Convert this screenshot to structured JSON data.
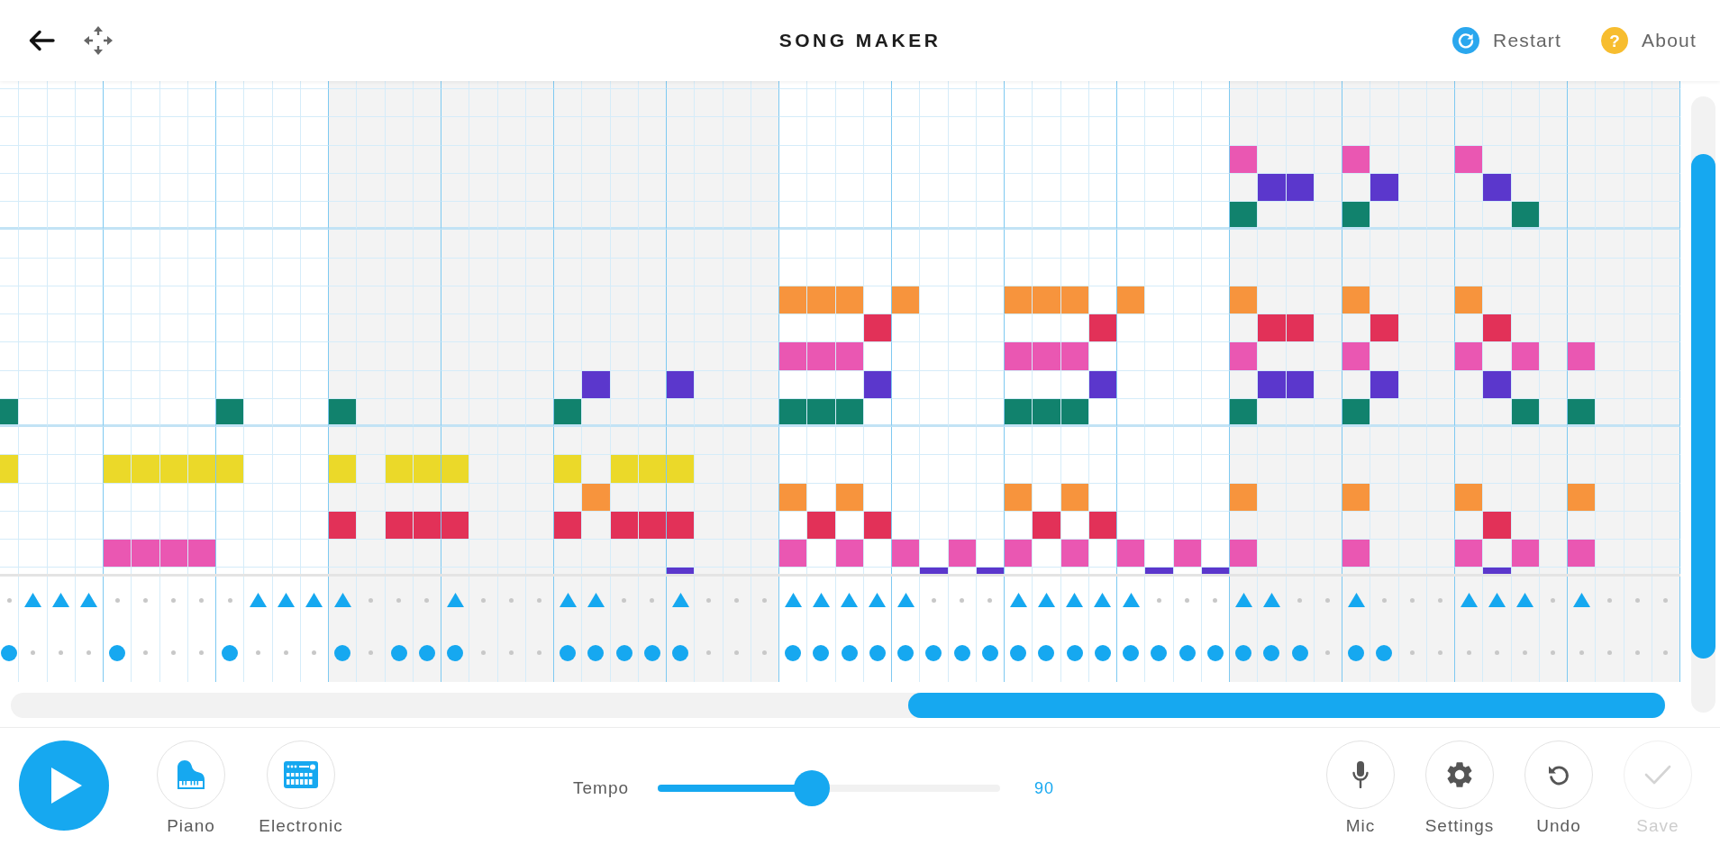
{
  "header": {
    "title": "SONG MAKER",
    "actions": [
      {
        "kind": "restart",
        "label": "Restart"
      },
      {
        "kind": "about",
        "label": "About",
        "icon": "?"
      }
    ]
  },
  "melody": {
    "rows": [
      {
        "cells": [
          false,
          false,
          false,
          false,
          false,
          false,
          false,
          false,
          false,
          false,
          false,
          false,
          false,
          false,
          false,
          false,
          false,
          false,
          false,
          false,
          false,
          false,
          false,
          false,
          false,
          false,
          false,
          false,
          false,
          false,
          false,
          false,
          false,
          false,
          false,
          false,
          false,
          false,
          false,
          false,
          false,
          false,
          false,
          false,
          false,
          false,
          false,
          false,
          false,
          false,
          false,
          false,
          false,
          false,
          false,
          false,
          false,
          false,
          false,
          false
        ]
      },
      {
        "cells": [
          false,
          false,
          false,
          false,
          false,
          false,
          false,
          false,
          false,
          false,
          false,
          false,
          false,
          false,
          false,
          false,
          false,
          false,
          false,
          false,
          false,
          false,
          false,
          false,
          false,
          false,
          false,
          false,
          false,
          false,
          false,
          false,
          false,
          false,
          false,
          false,
          false,
          false,
          false,
          false,
          false,
          false,
          false,
          false,
          false,
          false,
          false,
          false,
          false,
          false,
          false,
          false,
          false,
          false,
          false,
          false,
          false,
          false,
          false,
          false
        ]
      },
      {
        "color": "#ea57b2",
        "cells": [
          false,
          false,
          false,
          false,
          false,
          false,
          false,
          false,
          false,
          false,
          false,
          false,
          false,
          false,
          false,
          false,
          false,
          false,
          false,
          false,
          false,
          false,
          false,
          false,
          false,
          false,
          false,
          false,
          false,
          false,
          false,
          false,
          false,
          false,
          false,
          false,
          false,
          false,
          false,
          false,
          false,
          false,
          false,
          false,
          true,
          false,
          false,
          false,
          true,
          false,
          false,
          false,
          true,
          false,
          false,
          false,
          false,
          false,
          false,
          false
        ]
      },
      {
        "color": "#5b37cc",
        "cells": [
          false,
          false,
          false,
          false,
          false,
          false,
          false,
          false,
          false,
          false,
          false,
          false,
          false,
          false,
          false,
          false,
          false,
          false,
          false,
          false,
          false,
          false,
          false,
          false,
          false,
          false,
          false,
          false,
          false,
          false,
          false,
          false,
          false,
          false,
          false,
          false,
          false,
          false,
          false,
          false,
          false,
          false,
          false,
          false,
          false,
          true,
          true,
          false,
          false,
          true,
          false,
          false,
          false,
          true,
          false,
          false,
          false,
          false,
          false,
          false
        ]
      },
      {
        "color": "#11826d",
        "cells": [
          false,
          false,
          false,
          false,
          false,
          false,
          false,
          false,
          false,
          false,
          false,
          false,
          false,
          false,
          false,
          false,
          false,
          false,
          false,
          false,
          false,
          false,
          false,
          false,
          false,
          false,
          false,
          false,
          false,
          false,
          false,
          false,
          false,
          false,
          false,
          false,
          false,
          false,
          false,
          false,
          false,
          false,
          false,
          false,
          true,
          false,
          false,
          false,
          true,
          false,
          false,
          false,
          false,
          false,
          true,
          false,
          false,
          false,
          false,
          false
        ]
      },
      {
        "cells": [
          false,
          false,
          false,
          false,
          false,
          false,
          false,
          false,
          false,
          false,
          false,
          false,
          false,
          false,
          false,
          false,
          false,
          false,
          false,
          false,
          false,
          false,
          false,
          false,
          false,
          false,
          false,
          false,
          false,
          false,
          false,
          false,
          false,
          false,
          false,
          false,
          false,
          false,
          false,
          false,
          false,
          false,
          false,
          false,
          false,
          false,
          false,
          false,
          false,
          false,
          false,
          false,
          false,
          false,
          false,
          false,
          false,
          false,
          false,
          false
        ]
      },
      {
        "cells": [
          false,
          false,
          false,
          false,
          false,
          false,
          false,
          false,
          false,
          false,
          false,
          false,
          false,
          false,
          false,
          false,
          false,
          false,
          false,
          false,
          false,
          false,
          false,
          false,
          false,
          false,
          false,
          false,
          false,
          false,
          false,
          false,
          false,
          false,
          false,
          false,
          false,
          false,
          false,
          false,
          false,
          false,
          false,
          false,
          false,
          false,
          false,
          false,
          false,
          false,
          false,
          false,
          false,
          false,
          false,
          false,
          false,
          false,
          false,
          false
        ]
      },
      {
        "color": "#f7943d",
        "cells": [
          false,
          false,
          false,
          false,
          false,
          false,
          false,
          false,
          false,
          false,
          false,
          false,
          false,
          false,
          false,
          false,
          false,
          false,
          false,
          false,
          false,
          false,
          false,
          false,
          false,
          false,
          false,
          false,
          true,
          true,
          true,
          false,
          true,
          false,
          false,
          false,
          true,
          true,
          true,
          false,
          true,
          false,
          false,
          false,
          true,
          false,
          false,
          false,
          true,
          false,
          false,
          false,
          true,
          false,
          false,
          false,
          false,
          false,
          false,
          false
        ]
      },
      {
        "color": "#e23158",
        "cells": [
          false,
          false,
          false,
          false,
          false,
          false,
          false,
          false,
          false,
          false,
          false,
          false,
          false,
          false,
          false,
          false,
          false,
          false,
          false,
          false,
          false,
          false,
          false,
          false,
          false,
          false,
          false,
          false,
          false,
          false,
          false,
          true,
          false,
          false,
          false,
          false,
          false,
          false,
          false,
          true,
          false,
          false,
          false,
          false,
          false,
          true,
          true,
          false,
          false,
          true,
          false,
          false,
          false,
          true,
          false,
          false,
          false,
          false,
          false,
          false
        ]
      },
      {
        "color": "#ea57b2",
        "cells": [
          false,
          false,
          false,
          false,
          false,
          false,
          false,
          false,
          false,
          false,
          false,
          false,
          false,
          false,
          false,
          false,
          false,
          false,
          false,
          false,
          false,
          false,
          false,
          false,
          false,
          false,
          false,
          false,
          true,
          true,
          true,
          false,
          false,
          false,
          false,
          false,
          true,
          true,
          true,
          false,
          false,
          false,
          false,
          false,
          true,
          false,
          false,
          false,
          true,
          false,
          false,
          false,
          true,
          false,
          true,
          false,
          true,
          false,
          false,
          false
        ]
      },
      {
        "color": "#5b37cc",
        "cells": [
          false,
          false,
          false,
          false,
          false,
          false,
          false,
          false,
          false,
          false,
          false,
          false,
          false,
          false,
          false,
          false,
          false,
          false,
          false,
          false,
          false,
          true,
          false,
          false,
          true,
          false,
          false,
          false,
          false,
          false,
          false,
          true,
          false,
          false,
          false,
          false,
          false,
          false,
          false,
          true,
          false,
          false,
          false,
          false,
          false,
          true,
          true,
          false,
          false,
          true,
          false,
          false,
          false,
          true,
          false,
          false,
          false,
          false,
          false,
          false
        ]
      },
      {
        "color": "#11826d",
        "cells": [
          true,
          false,
          false,
          false,
          false,
          false,
          false,
          false,
          true,
          false,
          false,
          false,
          true,
          false,
          false,
          false,
          false,
          false,
          false,
          false,
          true,
          false,
          false,
          false,
          false,
          false,
          false,
          false,
          true,
          true,
          true,
          false,
          false,
          false,
          false,
          false,
          true,
          true,
          true,
          false,
          false,
          false,
          false,
          false,
          true,
          false,
          false,
          false,
          true,
          false,
          false,
          false,
          false,
          false,
          true,
          false,
          true,
          false,
          false,
          false
        ]
      },
      {
        "cells": [
          false,
          false,
          false,
          false,
          false,
          false,
          false,
          false,
          false,
          false,
          false,
          false,
          false,
          false,
          false,
          false,
          false,
          false,
          false,
          false,
          false,
          false,
          false,
          false,
          false,
          false,
          false,
          false,
          false,
          false,
          false,
          false,
          false,
          false,
          false,
          false,
          false,
          false,
          false,
          false,
          false,
          false,
          false,
          false,
          false,
          false,
          false,
          false,
          false,
          false,
          false,
          false,
          false,
          false,
          false,
          false,
          false,
          false,
          false,
          false
        ]
      },
      {
        "color": "#ebd929",
        "cells": [
          true,
          false,
          false,
          false,
          true,
          true,
          true,
          true,
          true,
          false,
          false,
          false,
          true,
          false,
          true,
          true,
          true,
          false,
          false,
          false,
          true,
          false,
          true,
          true,
          true,
          false,
          false,
          false,
          false,
          false,
          false,
          false,
          false,
          false,
          false,
          false,
          false,
          false,
          false,
          false,
          false,
          false,
          false,
          false,
          false,
          false,
          false,
          false,
          false,
          false,
          false,
          false,
          false,
          false,
          false,
          false,
          false,
          false,
          false,
          false
        ]
      },
      {
        "color": "#f7943d",
        "cells": [
          false,
          false,
          false,
          false,
          false,
          false,
          false,
          false,
          false,
          false,
          false,
          false,
          false,
          false,
          false,
          false,
          false,
          false,
          false,
          false,
          false,
          true,
          false,
          false,
          false,
          false,
          false,
          false,
          true,
          false,
          true,
          false,
          false,
          false,
          false,
          false,
          true,
          false,
          true,
          false,
          false,
          false,
          false,
          false,
          true,
          false,
          false,
          false,
          true,
          false,
          false,
          false,
          true,
          false,
          false,
          false,
          true,
          false,
          false,
          false
        ]
      },
      {
        "color": "#e23158",
        "cells": [
          false,
          false,
          false,
          false,
          false,
          false,
          false,
          false,
          false,
          false,
          false,
          false,
          true,
          false,
          true,
          true,
          true,
          false,
          false,
          false,
          true,
          false,
          true,
          true,
          true,
          false,
          false,
          false,
          false,
          true,
          false,
          true,
          false,
          false,
          false,
          false,
          false,
          true,
          false,
          true,
          false,
          false,
          false,
          false,
          false,
          false,
          false,
          false,
          false,
          false,
          false,
          false,
          false,
          true,
          false,
          false,
          false,
          false,
          false,
          false
        ]
      },
      {
        "color": "#ea57b2",
        "cells": [
          false,
          false,
          false,
          false,
          true,
          true,
          true,
          true,
          false,
          false,
          false,
          false,
          false,
          false,
          false,
          false,
          false,
          false,
          false,
          false,
          false,
          false,
          false,
          false,
          false,
          false,
          false,
          false,
          true,
          false,
          true,
          false,
          true,
          false,
          true,
          false,
          true,
          false,
          true,
          false,
          true,
          false,
          true,
          false,
          true,
          false,
          false,
          false,
          true,
          false,
          false,
          false,
          true,
          false,
          true,
          false,
          true,
          false,
          false,
          false
        ]
      },
      {
        "color": "#5b37cc",
        "cells": [
          false,
          false,
          false,
          false,
          false,
          false,
          false,
          false,
          false,
          false,
          false,
          false,
          false,
          false,
          false,
          false,
          false,
          false,
          false,
          false,
          false,
          false,
          false,
          false,
          true,
          false,
          false,
          false,
          false,
          false,
          false,
          false,
          false,
          true,
          false,
          true,
          false,
          false,
          false,
          false,
          false,
          true,
          false,
          true,
          false,
          false,
          false,
          false,
          false,
          false,
          false,
          false,
          false,
          true,
          false,
          false,
          false,
          false,
          false,
          false
        ]
      }
    ]
  },
  "rhythm": {
    "rows": [
      {
        "kind": "triangle",
        "cells": [
          false,
          true,
          true,
          true,
          false,
          false,
          false,
          false,
          false,
          true,
          true,
          true,
          true,
          false,
          false,
          false,
          true,
          false,
          false,
          false,
          true,
          true,
          false,
          false,
          true,
          false,
          false,
          false,
          true,
          true,
          true,
          true,
          true,
          false,
          false,
          false,
          true,
          true,
          true,
          true,
          true,
          false,
          false,
          false,
          true,
          true,
          false,
          false,
          true,
          false,
          false,
          false,
          true,
          true,
          true,
          false,
          true,
          false,
          false,
          false
        ]
      },
      {
        "kind": "circle",
        "cells": [
          true,
          false,
          false,
          false,
          true,
          false,
          false,
          false,
          true,
          false,
          false,
          false,
          true,
          false,
          true,
          true,
          true,
          false,
          false,
          false,
          true,
          true,
          true,
          true,
          true,
          false,
          false,
          false,
          true,
          true,
          true,
          true,
          true,
          true,
          true,
          true,
          true,
          true,
          true,
          true,
          true,
          true,
          true,
          true,
          true,
          true,
          true,
          false,
          true,
          true,
          false,
          false,
          false,
          false,
          false,
          false,
          false,
          false,
          false,
          false
        ]
      }
    ]
  },
  "toolbar": {
    "instruments": [
      {
        "kind": "piano",
        "label": "Piano"
      },
      {
        "kind": "electronic",
        "label": "Electronic"
      }
    ],
    "tempo": {
      "label": "Tempo",
      "level": 0.45,
      "reading": "90"
    },
    "tools": [
      {
        "kind": "mic",
        "label": "Mic",
        "disabled": false
      },
      {
        "kind": "settings",
        "label": "Settings",
        "disabled": false
      },
      {
        "kind": "undo",
        "label": "Undo",
        "disabled": false
      },
      {
        "kind": "save",
        "label": "Save",
        "disabled": true
      }
    ]
  }
}
